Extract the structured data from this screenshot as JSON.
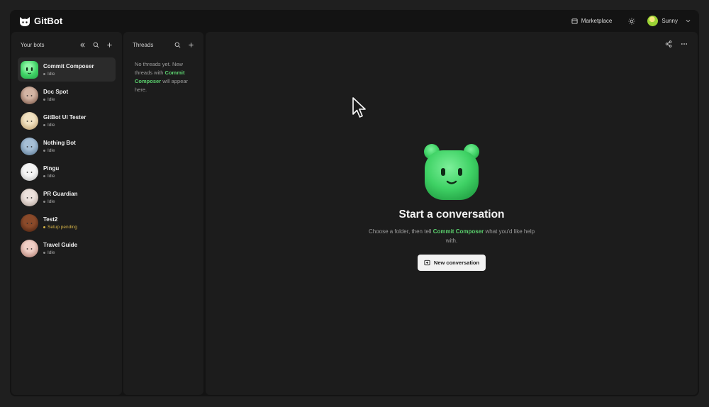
{
  "app": {
    "name": "GitBot"
  },
  "topbar": {
    "marketplace_label": "Marketplace",
    "user_name": "Sunny"
  },
  "bots_panel": {
    "title": "Your bots",
    "bots": [
      {
        "name": "Commit Composer",
        "status": "Idle",
        "active": true,
        "avatar": "green-bear"
      },
      {
        "name": "Doc Spot",
        "status": "Idle",
        "avatar": "brown-ghost"
      },
      {
        "name": "GitBot UI Tester",
        "status": "Idle",
        "avatar": "cream-ghost"
      },
      {
        "name": "Nothing Bot",
        "status": "Idle",
        "avatar": "blue-bear"
      },
      {
        "name": "Pingu",
        "status": "Idle",
        "avatar": "white-ghost"
      },
      {
        "name": "PR Guardian",
        "status": "Idle",
        "avatar": "grey-bear"
      },
      {
        "name": "Test2",
        "status": "Setup pending",
        "avatar": "brown-blob"
      },
      {
        "name": "Travel Guide",
        "status": "Idle",
        "avatar": "pink-ghost"
      }
    ]
  },
  "threads_panel": {
    "title": "Threads",
    "empty_prefix": "No threads yet. New threads with",
    "empty_bot": "Commit Composer",
    "empty_suffix": "will appear here."
  },
  "main": {
    "title": "Start a conversation",
    "subtitle_prefix": "Choose a folder, then tell",
    "subtitle_bot": "Commit Composer",
    "subtitle_suffix": "what you'd like help with.",
    "new_conversation_label": "New conversation"
  },
  "colors": {
    "accent_green": "#5bd16e",
    "pending_yellow": "#d4b246",
    "background": "#131313",
    "panel": "#1c1c1c"
  }
}
